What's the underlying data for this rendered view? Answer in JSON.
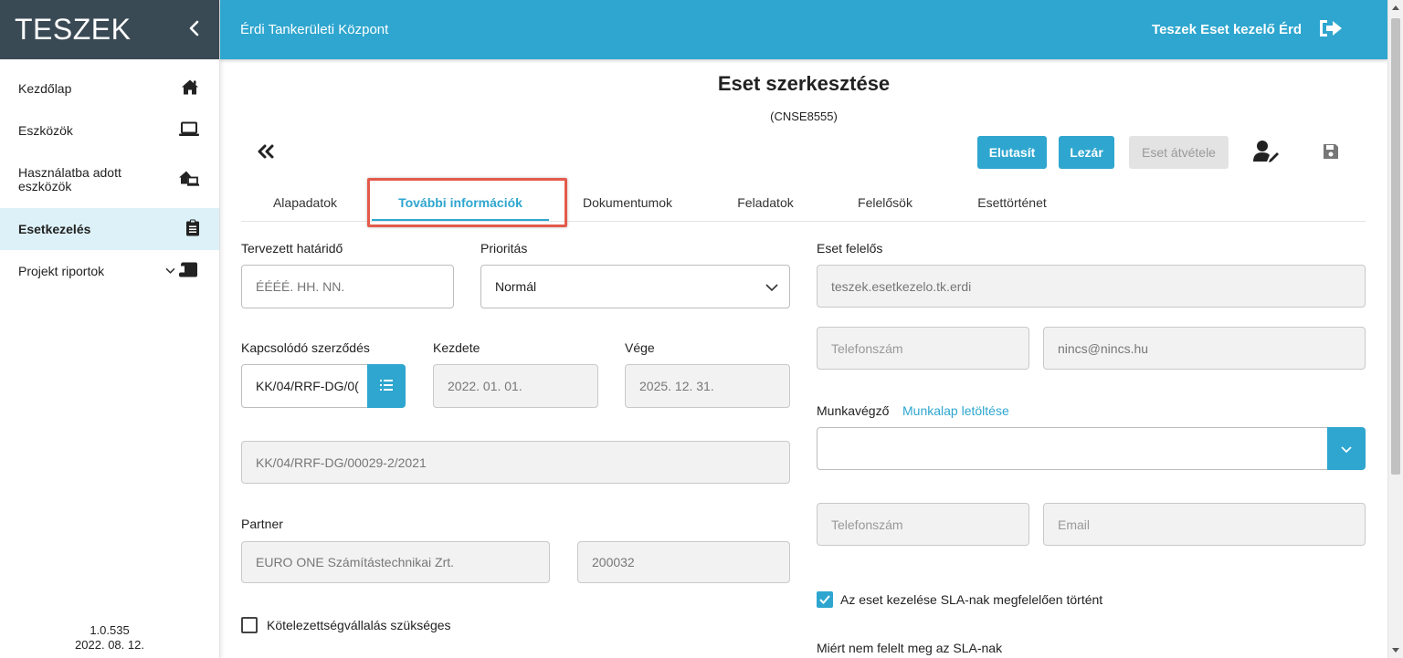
{
  "sidebar": {
    "brand": "TESZEK",
    "items": [
      {
        "label": "Kezdőlap",
        "icon": "home-icon"
      },
      {
        "label": "Eszközök",
        "icon": "laptop-icon"
      },
      {
        "label": "Használatba adott\neszközök",
        "icon": "house-laptop-icon"
      },
      {
        "label": "Esetkezelés",
        "icon": "clipboard-icon",
        "active": true
      },
      {
        "label": "Projekt riportok",
        "icon": "scroll-icon"
      }
    ],
    "version": "1.0.535",
    "date": "2022. 08. 12."
  },
  "topbar": {
    "organization": "Érdi Tankerületi Központ",
    "user": "Teszek Eset kezelő Érd"
  },
  "page": {
    "title": "Eset szerkesztése",
    "case_id": "(CNSE8555)"
  },
  "actions": {
    "reject": "Elutasít",
    "close": "Lezár",
    "take_over": "Eset átvétele"
  },
  "tabs": [
    {
      "label": "Alapadatok"
    },
    {
      "label": "További információk",
      "active": true
    },
    {
      "label": "Dokumentumok"
    },
    {
      "label": "Feladatok"
    },
    {
      "label": "Felelősök"
    },
    {
      "label": "Esettörténet"
    }
  ],
  "form": {
    "deadline": {
      "label": "Tervezett határidő",
      "placeholder": "ÉÉÉÉ. HH. NN."
    },
    "priority": {
      "label": "Prioritás",
      "value": "Normál"
    },
    "contract": {
      "label": "Kapcsolódó szerződés",
      "value": "KK/04/RRF-DG/0("
    },
    "start": {
      "label": "Kezdete",
      "value": "2022. 01. 01."
    },
    "end": {
      "label": "Vége",
      "value": "2025. 12. 31."
    },
    "contract_full": "KK/04/RRF-DG/00029-2/2021",
    "partner": {
      "label": "Partner",
      "name": "EURO ONE Számítástechnikai Zrt.",
      "code": "200032"
    },
    "commitment": {
      "label": "Kötelezettségvállalás szükséges",
      "checked": false
    },
    "responsible": {
      "label": "Eset felelős",
      "value": "teszek.esetkezelo.tk.erdi",
      "phone_placeholder": "Telefonszám",
      "email": "nincs@nincs.hu"
    },
    "worker": {
      "label": "Munkavégző",
      "download_link": "Munkalap letöltése",
      "value": "",
      "phone_placeholder": "Telefonszám",
      "email_placeholder": "Email"
    },
    "sla": {
      "label": "Az eset kezelése SLA-nak megfelelően történt",
      "checked": true
    },
    "sla_reason_label": "Miért nem felelt meg az SLA-nak"
  },
  "colors": {
    "accent": "#2ea6cf",
    "sidebar_header": "#3a4a55",
    "active_nav_bg": "#ddf1f8",
    "highlight": "#e35a4b"
  }
}
